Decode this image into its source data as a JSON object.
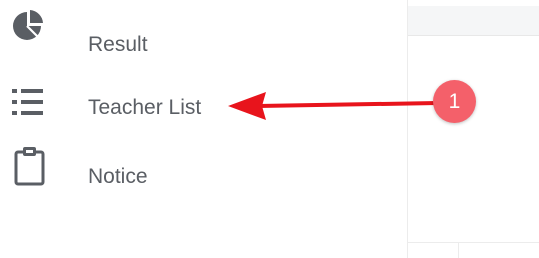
{
  "sidebar": {
    "items": [
      {
        "label": "Result",
        "icon": "pie-chart-icon"
      },
      {
        "label": "Teacher List",
        "icon": "list-icon"
      },
      {
        "label": "Notice",
        "icon": "clipboard-icon"
      }
    ]
  },
  "annotation": {
    "badge_number": "1",
    "arrow_color": "#e8141c",
    "badge_color": "#f4606a"
  },
  "colors": {
    "icon": "#5a5e64",
    "label": "#5a5e64"
  }
}
